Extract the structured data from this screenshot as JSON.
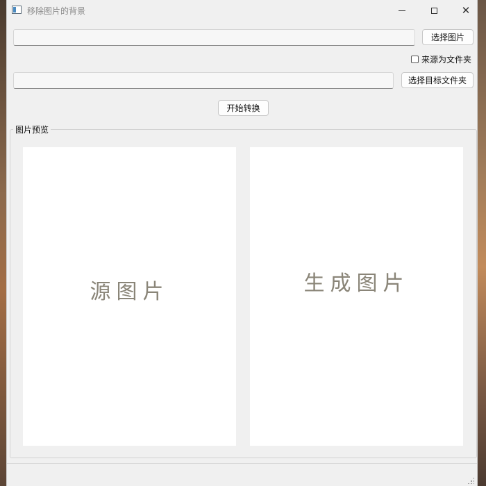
{
  "window": {
    "title": "移除图片的背景",
    "minimize_icon": "minimize-icon",
    "maximize_icon": "maximize-icon",
    "close_icon": "close-icon",
    "close_glyph": "✕"
  },
  "source": {
    "path_value": "",
    "choose_button_label": "选择图片",
    "folder_checkbox_label": "来源为文件夹",
    "folder_checkbox_checked": false
  },
  "target": {
    "path_value": "",
    "choose_button_label": "选择目标文件夹"
  },
  "actions": {
    "start_button_label": "开始转换"
  },
  "preview_group": {
    "title": "图片预览",
    "source_placeholder": "源图片",
    "result_placeholder": "生成图片"
  },
  "colors": {
    "window_bg": "#f0f0f0",
    "preview_bg": "#ffffff",
    "placeholder_text": "#8a8578"
  }
}
